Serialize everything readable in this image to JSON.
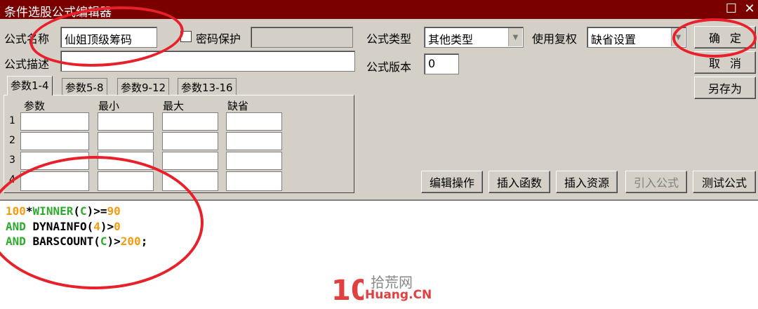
{
  "window": {
    "title": "条件选股公式编辑器",
    "maximize_glyph": "☐",
    "close_glyph": "✕"
  },
  "form": {
    "name_label": "公式名称",
    "name_value": "仙姐顶级筹码",
    "password_label": "密码保护",
    "password_checked": false,
    "password_value": "",
    "desc_label": "公式描述",
    "desc_value": "",
    "type_label": "公式类型",
    "type_value": "其他类型",
    "fq_label": "使用复权",
    "fq_value": "缺省设置",
    "version_label": "公式版本",
    "version_value": "0"
  },
  "buttons": {
    "ok": "确定",
    "cancel": "取消",
    "save_as": "另存为",
    "edit_ops": "编辑操作",
    "insert_func": "插入函数",
    "insert_res": "插入资源",
    "import_formula": "引入公式",
    "test_formula": "测试公式"
  },
  "tabs": [
    "参数1-4",
    "参数5-8",
    "参数9-12",
    "参数13-16"
  ],
  "params": {
    "headers": [
      "参数",
      "最小",
      "最大",
      "缺省"
    ],
    "rows": [
      "1",
      "2",
      "3",
      "4"
    ]
  },
  "code": {
    "lines": [
      [
        {
          "t": "100",
          "c": "num"
        },
        {
          "t": "*",
          "c": "op"
        },
        {
          "t": "WINNER",
          "c": "func"
        },
        {
          "t": "(",
          "c": "op"
        },
        {
          "t": "C",
          "c": "func"
        },
        {
          "t": ")>=",
          "c": "op"
        },
        {
          "t": "90",
          "c": "num"
        }
      ],
      [
        {
          "t": "AND",
          "c": "kw"
        },
        {
          "t": " DYNAINFO(",
          "c": "op"
        },
        {
          "t": "4",
          "c": "num"
        },
        {
          "t": ")>",
          "c": "op"
        },
        {
          "t": "0",
          "c": "num"
        }
      ],
      [
        {
          "t": "AND",
          "c": "kw"
        },
        {
          "t": " BARSCOUNT(",
          "c": "op"
        },
        {
          "t": "C",
          "c": "func"
        },
        {
          "t": ")>",
          "c": "op"
        },
        {
          "t": "200",
          "c": "num"
        },
        {
          "t": ";",
          "c": "op"
        }
      ]
    ]
  },
  "watermark": {
    "logo": "10",
    "line1": "拾荒网",
    "line2": "Huang.CN"
  },
  "colors": {
    "titlebar": "#7a0000",
    "highlight_ring": "#e8202a",
    "code_number": "#f39c12",
    "code_function": "#2eab2e"
  }
}
